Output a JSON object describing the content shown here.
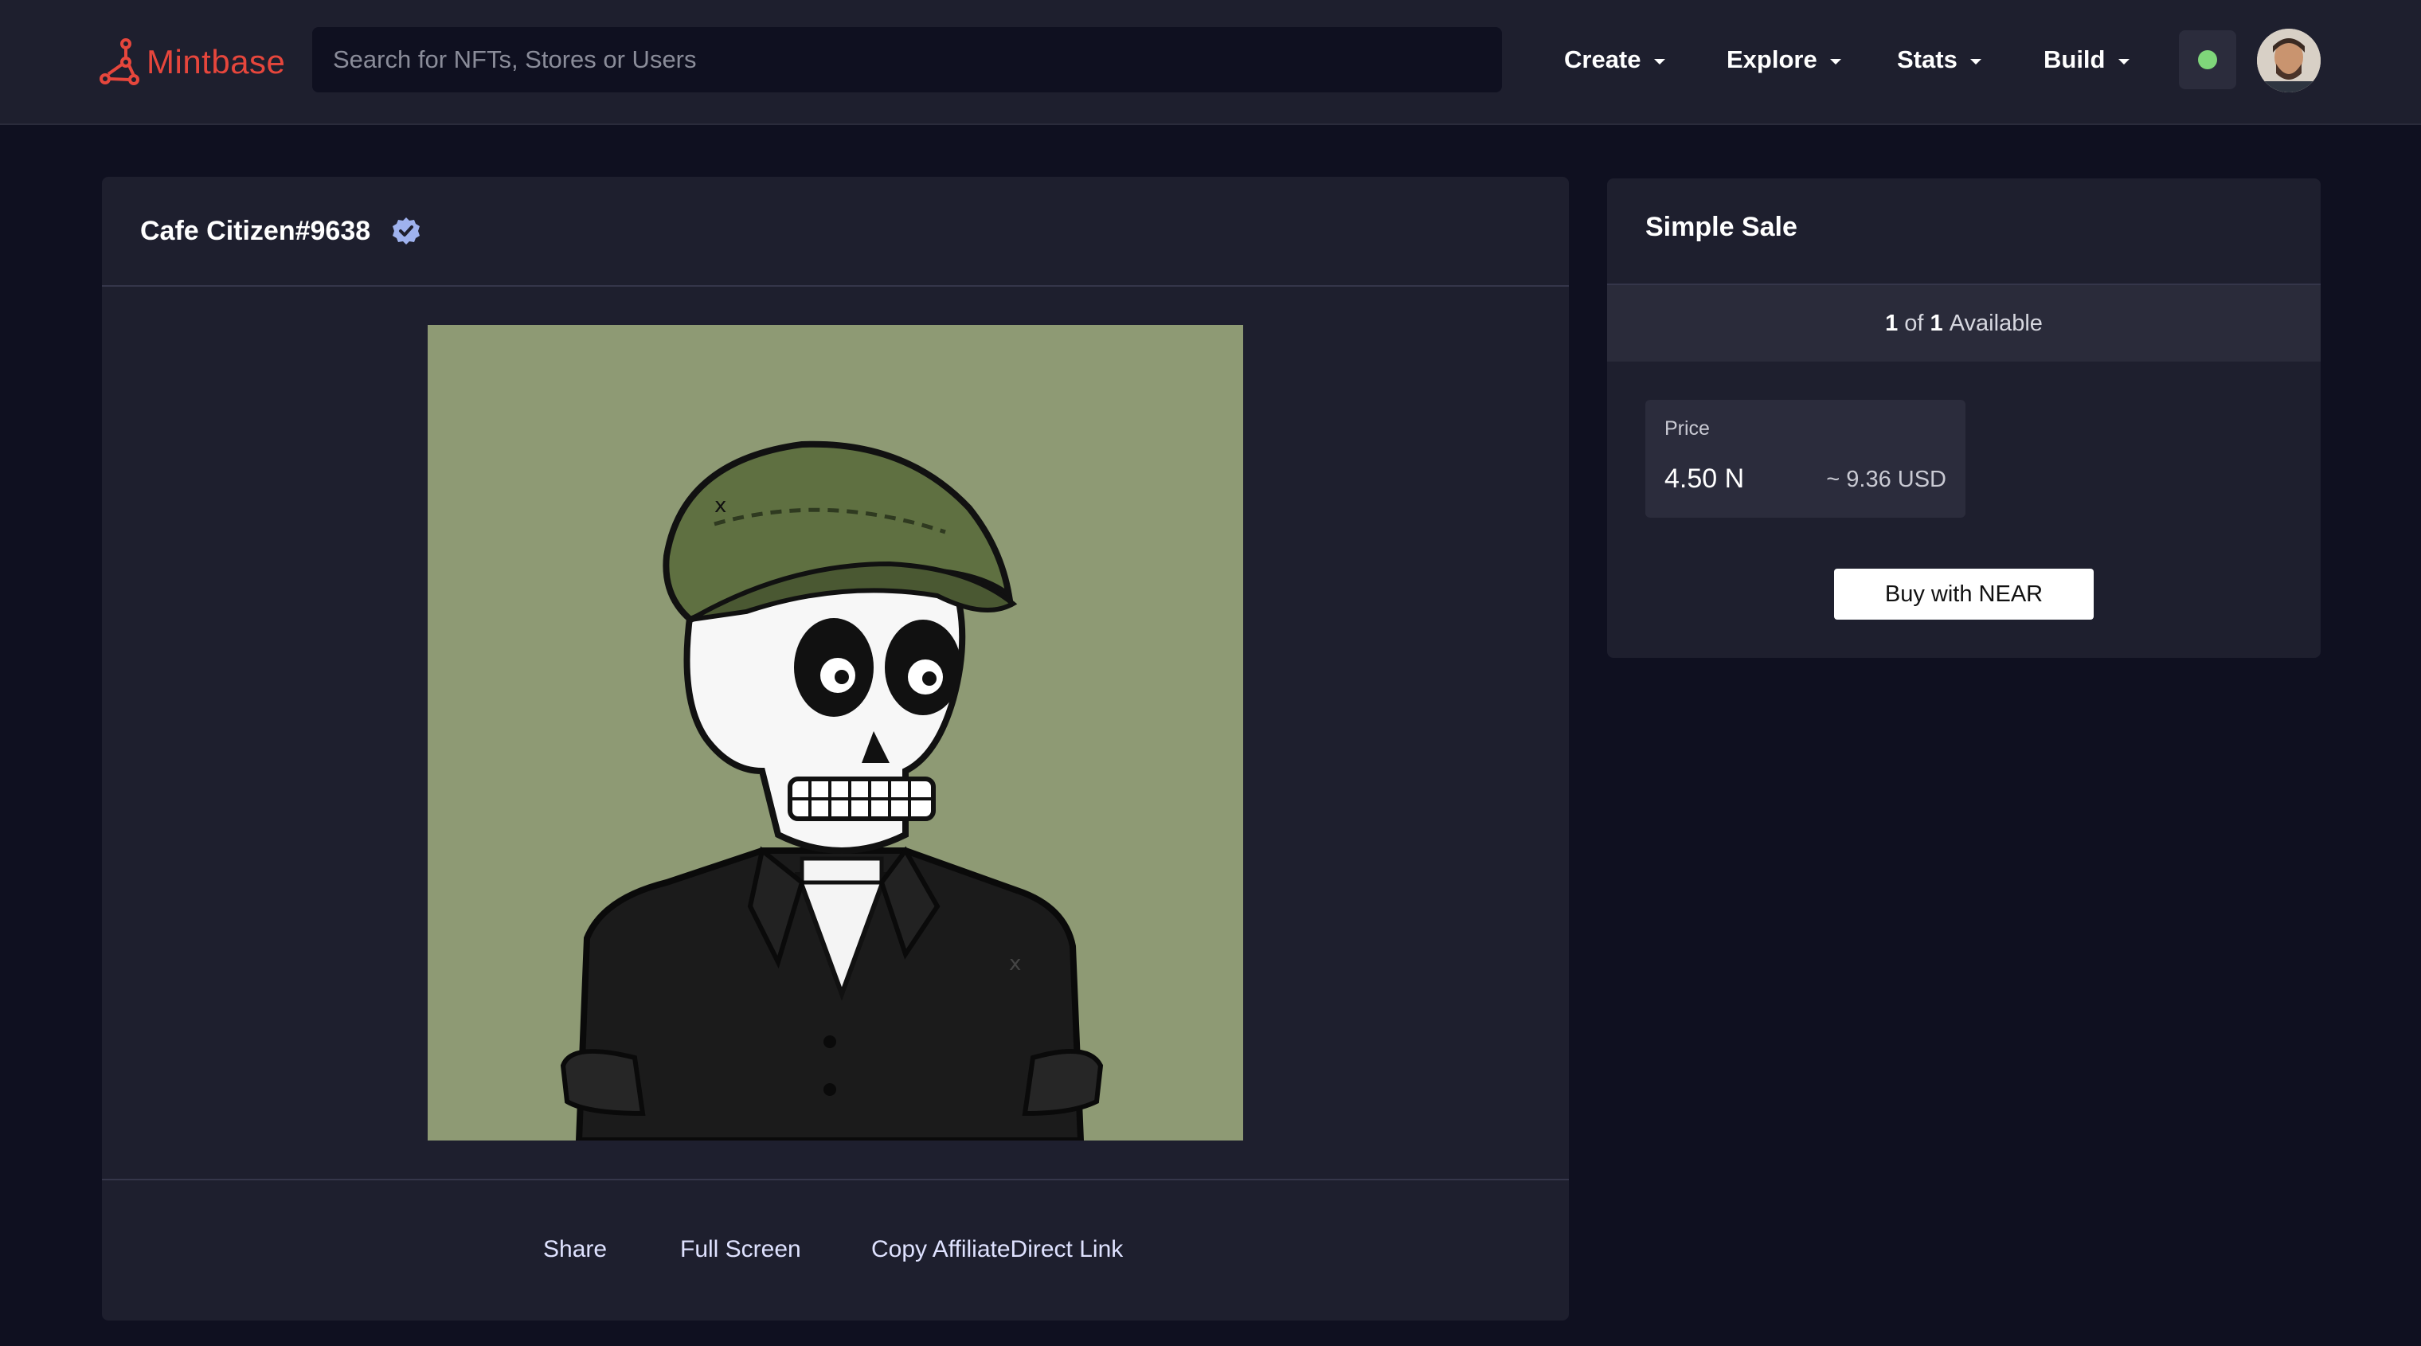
{
  "header": {
    "logo_text": "Mintbase",
    "search_placeholder": "Search for NFTs, Stores or Users",
    "nav": [
      {
        "label": "Create"
      },
      {
        "label": "Explore"
      },
      {
        "label": "Stats"
      },
      {
        "label": "Build"
      }
    ]
  },
  "nft": {
    "title": "Cafe Citizen#9638",
    "actions": {
      "share": "Share",
      "full_screen": "Full Screen",
      "copy_link": "Copy AffiliateDirect Link"
    }
  },
  "sale": {
    "title": "Simple Sale",
    "available_count": "1",
    "available_of": "of",
    "available_total": "1",
    "available_label": "Available",
    "price_label": "Price",
    "price_near": "4.50 N",
    "price_usd": "~ 9.36 USD",
    "buy_label": "Buy with NEAR"
  },
  "colors": {
    "brand": "#e6463c",
    "background": "#0f1020",
    "panel": "#1e1f2e",
    "status": "#7fd67a",
    "art_background": "#8e9a74"
  },
  "icons": {
    "logo": "mintbase-logo-icon",
    "verified": "verified-badge-icon",
    "caret": "chevron-down-icon"
  }
}
